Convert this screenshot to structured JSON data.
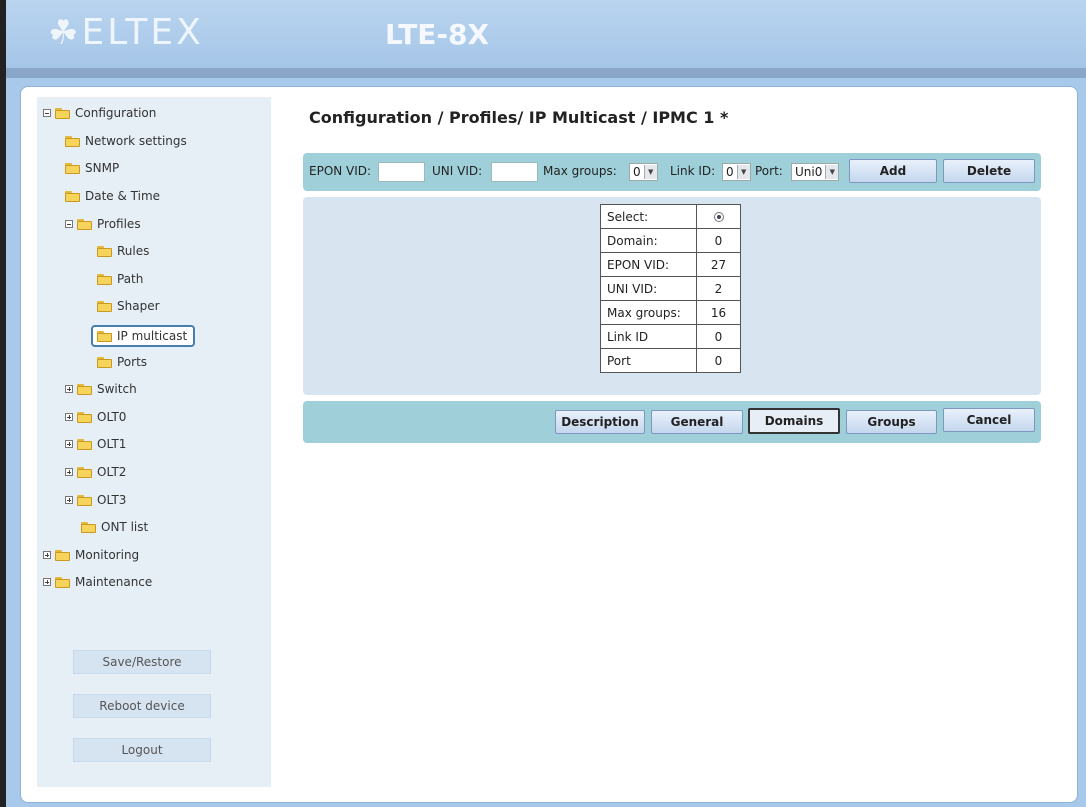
{
  "header": {
    "logo_text": "ELTEX",
    "model": "LTE-8X"
  },
  "sidebar": {
    "tree": [
      {
        "label": "Configuration",
        "expander": "minus",
        "level": 0
      },
      {
        "label": "Network settings",
        "expander": "",
        "level": 1
      },
      {
        "label": "SNMP",
        "expander": "",
        "level": 1
      },
      {
        "label": "Date & Time",
        "expander": "",
        "level": 1
      },
      {
        "label": "Profiles",
        "expander": "minus",
        "level": 1
      },
      {
        "label": "Rules",
        "expander": "",
        "level": 2
      },
      {
        "label": "Path",
        "expander": "",
        "level": 2
      },
      {
        "label": "Shaper",
        "expander": "",
        "level": 2
      },
      {
        "label": "IP multicast",
        "expander": "",
        "level": 2,
        "selected": true
      },
      {
        "label": "Ports",
        "expander": "",
        "level": 2
      },
      {
        "label": "Switch",
        "expander": "plus",
        "level": 1
      },
      {
        "label": "OLT0",
        "expander": "plus",
        "level": 1
      },
      {
        "label": "OLT1",
        "expander": "plus",
        "level": 1
      },
      {
        "label": "OLT2",
        "expander": "plus",
        "level": 1
      },
      {
        "label": "OLT3",
        "expander": "plus",
        "level": 1
      },
      {
        "label": "ONT list",
        "expander": "",
        "level": 1
      },
      {
        "label": "Monitoring",
        "expander": "plus",
        "level": 0
      },
      {
        "label": "Maintenance",
        "expander": "plus",
        "level": 0
      }
    ],
    "buttons": {
      "save_restore": "Save/Restore",
      "reboot": "Reboot device",
      "logout": "Logout"
    }
  },
  "main": {
    "title": "Configuration / Profiles/ IP Multicast / IPMC 1 *",
    "toolbar": {
      "epon_vid_label": "EPON VID:",
      "epon_vid_value": "",
      "uni_vid_label": "UNI VID:",
      "uni_vid_value": "",
      "max_groups_label": "Max groups:",
      "max_groups_value": "0",
      "link_id_label": "Link ID:",
      "link_id_value": "0",
      "port_label": "Port:",
      "port_value": "Uni0",
      "add_label": "Add",
      "delete_label": "Delete"
    },
    "table": [
      {
        "key": "Select:",
        "value": ""
      },
      {
        "key": "Domain:",
        "value": "0"
      },
      {
        "key": "EPON VID:",
        "value": "27"
      },
      {
        "key": "UNI VID:",
        "value": "2"
      },
      {
        "key": "Max groups:",
        "value": "16"
      },
      {
        "key": "Link ID",
        "value": "0"
      },
      {
        "key": "Port",
        "value": "0"
      }
    ],
    "bottom_buttons": {
      "description": "Description",
      "general": "General",
      "domains": "Domains",
      "groups": "Groups",
      "cancel": "Cancel"
    }
  }
}
